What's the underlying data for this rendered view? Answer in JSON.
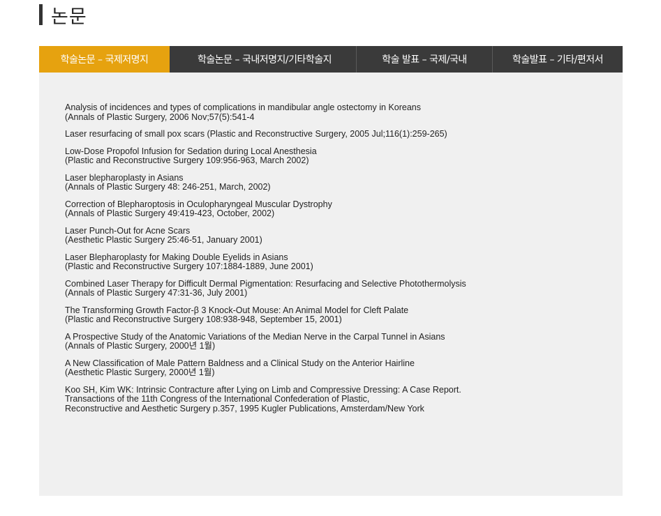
{
  "page": {
    "title": "논문"
  },
  "tabs": [
    {
      "label": "학술논문 – 국제저명지",
      "active": true
    },
    {
      "label": "학술논문 – 국내저명지/기타학술지",
      "active": false
    },
    {
      "label": "학술 발표 – 국제/국내",
      "active": false
    },
    {
      "label": "학술발표 – 기타/편저서",
      "active": false
    }
  ],
  "publications": [
    {
      "lines": [
        "Analysis of incidences and types of complications in mandibular angle ostectomy in Koreans",
        "(Annals of Plastic Surgery, 2006 Nov;57(5):541-4"
      ]
    },
    {
      "lines": [
        "Laser resurfacing of small pox scars (Plastic and Reconstructive Surgery, 2005 Jul;116(1):259-265)"
      ]
    },
    {
      "lines": [
        "Low-Dose Propofol Infusion for Sedation during Local Anesthesia",
        "(Plastic and Reconstructive Surgery 109:956-963, March 2002)"
      ]
    },
    {
      "lines": [
        "Laser blepharoplasty in Asians",
        "(Annals of Plastic Surgery 48: 246-251, March, 2002)"
      ]
    },
    {
      "lines": [
        "Correction of Blepharoptosis in Oculopharyngeal Muscular Dystrophy",
        "(Annals of Plastic Surgery 49:419-423, October, 2002)"
      ]
    },
    {
      "lines": [
        "Laser Punch-Out for Acne Scars",
        "(Aesthetic Plastic Surgery 25:46-51, January 2001)"
      ]
    },
    {
      "lines": [
        "Laser Blepharoplasty for Making Double Eyelids in Asians",
        "(Plastic and Reconstructive Surgery 107:1884-1889, June 2001)"
      ]
    },
    {
      "lines": [
        "Combined Laser Therapy for Difficult Dermal Pigmentation: Resurfacing and Selective Photothermolysis",
        "(Annals of Plastic Surgery 47:31-36, July 2001)"
      ]
    },
    {
      "lines": [
        "The Transforming Growth Factor-β 3 Knock-Out Mouse: An Animal Model for Cleft Palate",
        "(Plastic and Reconstructive Surgery 108:938-948, September 15, 2001)"
      ]
    },
    {
      "lines": [
        "A Prospective Study of the Anatomic Variations of the Median Nerve in the Carpal Tunnel in Asians",
        "(Annals of Plastic Surgery, 2000년 1월)"
      ]
    },
    {
      "lines": [
        "A New Classification of Male Pattern Baldness and a Clinical Study on the Anterior Hairline",
        "(Aesthetic Plastic Surgery, 2000년 1월)"
      ]
    },
    {
      "lines": [
        "Koo SH, Kim WK: Intrinsic Contracture after Lying on Limb and Compressive Dressing: A Case Report.",
        "Transactions of the 11th Congress of the International Confederation of Plastic,",
        "Reconstructive and Aesthetic Surgery p.357, 1995 Kugler Publications, Amsterdam/New York"
      ]
    }
  ],
  "colors": {
    "active_tab": "#e6a20f",
    "tab_bar": "#3a3a3a",
    "content_bg": "#f0f0f0"
  }
}
